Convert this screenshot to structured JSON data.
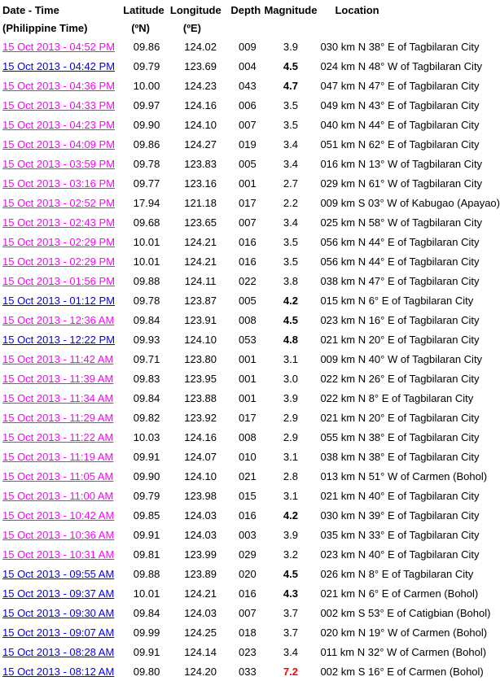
{
  "header": {
    "date_time": "Date - Time",
    "date_time_sub": "(Philippine Time)",
    "latitude": "Latitude",
    "latitude_sub": "(ºN)",
    "longitude": "Longitude",
    "longitude_sub": "(ºE)",
    "depth": "Depth",
    "magnitude": "Magnitude",
    "location": "Location"
  },
  "colors": {
    "link_visited": "#ff00ff",
    "link_unvisited": "#0000ee",
    "magnitude_major": "#ff0000"
  },
  "rows": [
    {
      "datetime": "15 Oct 2013 - 04:52 PM",
      "link": "visited",
      "lat": "09.86",
      "lon": "124.02",
      "depth": "009",
      "mag": "3.9",
      "mag_style": "normal",
      "location": "030 km N 38° E of Tagbilaran City"
    },
    {
      "datetime": "15 Oct 2013 - 04:42 PM",
      "link": "unvisited",
      "lat": "09.79",
      "lon": "123.69",
      "depth": "004",
      "mag": "4.5",
      "mag_style": "bold",
      "location": "024 km N 48° W of Tagbilaran City"
    },
    {
      "datetime": "15 Oct 2013 - 04:36 PM",
      "link": "visited",
      "lat": "10.00",
      "lon": "124.23",
      "depth": "043",
      "mag": "4.7",
      "mag_style": "bold",
      "location": "047 km N 47° E of Tagbilaran City"
    },
    {
      "datetime": "15 Oct 2013 - 04:33 PM",
      "link": "visited",
      "lat": "09.97",
      "lon": "124.16",
      "depth": "006",
      "mag": "3.5",
      "mag_style": "normal",
      "location": "049 km N 43° E of Tagbilaran City"
    },
    {
      "datetime": "15 Oct 2013 - 04:23 PM",
      "link": "visited",
      "lat": "09.90",
      "lon": "124.10",
      "depth": "007",
      "mag": "3.5",
      "mag_style": "normal",
      "location": "040 km N 44° E of Tagbilaran City"
    },
    {
      "datetime": "15 Oct 2013 - 04:09 PM",
      "link": "visited",
      "lat": "09.86",
      "lon": "124.27",
      "depth": "019",
      "mag": "3.4",
      "mag_style": "normal",
      "location": "051 km N 62° E of Tagbilaran City"
    },
    {
      "datetime": "15 Oct 2013 - 03:59 PM",
      "link": "visited",
      "lat": "09.78",
      "lon": "123.83",
      "depth": "005",
      "mag": "3.4",
      "mag_style": "normal",
      "location": "016 km N 13° W of Tagbilaran City"
    },
    {
      "datetime": "15 Oct 2013 - 03:16 PM",
      "link": "visited",
      "lat": "09.77",
      "lon": "123.16",
      "depth": "001",
      "mag": "2.7",
      "mag_style": "normal",
      "location": "029 km N 61° W of Tagbilaran City"
    },
    {
      "datetime": "15 Oct 2013 - 02:52 PM",
      "link": "visited",
      "lat": "17.94",
      "lon": "121.18",
      "depth": "017",
      "mag": "2.2",
      "mag_style": "normal",
      "location": "009 km S 03° W of Kabugao (Apayao)"
    },
    {
      "datetime": "15 Oct 2013 - 02:43 PM",
      "link": "visited",
      "lat": "09.68",
      "lon": "123.65",
      "depth": "007",
      "mag": "3.4",
      "mag_style": "normal",
      "location": "025 km N 58° W of Tagbilaran City"
    },
    {
      "datetime": "15 Oct 2013 - 02:29 PM",
      "link": "visited",
      "lat": "10.01",
      "lon": "124.21",
      "depth": "016",
      "mag": "3.5",
      "mag_style": "normal",
      "location": "056 km N 44° E of Tagbilaran City"
    },
    {
      "datetime": "15 Oct 2013 - 02:29 PM",
      "link": "visited",
      "lat": "10.01",
      "lon": "124.21",
      "depth": "016",
      "mag": "3.5",
      "mag_style": "normal",
      "location": "056 km N 44° E of Tagbilaran City"
    },
    {
      "datetime": "15 Oct 2013 - 01:56 PM",
      "link": "visited",
      "lat": "09.88",
      "lon": "124.11",
      "depth": "022",
      "mag": "3.8",
      "mag_style": "normal",
      "location": "038 km N 47° E of Tagbilaran City"
    },
    {
      "datetime": "15 Oct 2013 - 01:12 PM",
      "link": "unvisited",
      "lat": "09.78",
      "lon": "123.87",
      "depth": "005",
      "mag": "4.2",
      "mag_style": "bold",
      "location": "015 km N 6° E of Tagbilaran City"
    },
    {
      "datetime": "15 Oct 2013 - 12:36 AM",
      "link": "visited",
      "lat": "09.84",
      "lon": "123.91",
      "depth": "008",
      "mag": "4.5",
      "mag_style": "bold",
      "location": "023 km N 16° E of Tagbilaran City"
    },
    {
      "datetime": "15 Oct 2013 - 12:22 PM",
      "link": "unvisited",
      "lat": "09.93",
      "lon": "124.10",
      "depth": "053",
      "mag": "4.8",
      "mag_style": "bold",
      "location": "021 km N 20° E of Tagbilaran City"
    },
    {
      "datetime": "15 Oct 2013 - 11:42 AM",
      "link": "visited",
      "lat": "09.71",
      "lon": "123.80",
      "depth": "001",
      "mag": "3.1",
      "mag_style": "normal",
      "location": "009 km N 40° W of Tagbilaran City"
    },
    {
      "datetime": "15 Oct 2013 - 11:39 AM",
      "link": "visited",
      "lat": "09.83",
      "lon": "123.95",
      "depth": "001",
      "mag": "3.0",
      "mag_style": "normal",
      "location": "022 km N 26° E of Tagbilaran City"
    },
    {
      "datetime": "15 Oct 2013 - 11:34 AM",
      "link": "visited",
      "lat": "09.84",
      "lon": "123.88",
      "depth": "001",
      "mag": "3.9",
      "mag_style": "normal",
      "location": "022 km N 8° E of Tagbilaran City"
    },
    {
      "datetime": "15 Oct 2013 - 11:29 AM",
      "link": "visited",
      "lat": "09.82",
      "lon": "123.92",
      "depth": "017",
      "mag": "2.9",
      "mag_style": "normal",
      "location": "021 km N 20° E of Tagbilaran City"
    },
    {
      "datetime": "15 Oct 2013 - 11:22 AM",
      "link": "visited",
      "lat": "10.03",
      "lon": "124.16",
      "depth": "008",
      "mag": "2.9",
      "mag_style": "normal",
      "location": "055 km N 38° E of Tagbilaran City"
    },
    {
      "datetime": "15 Oct 2013 - 11:19 AM",
      "link": "visited",
      "lat": "09.91",
      "lon": "124.07",
      "depth": "010",
      "mag": "3.1",
      "mag_style": "normal",
      "location": "038 km N 38° E of Tagbilaran City"
    },
    {
      "datetime": "15 Oct 2013 - 11:05 AM",
      "link": "visited",
      "lat": "09.90",
      "lon": "124.10",
      "depth": "021",
      "mag": "2.8",
      "mag_style": "normal",
      "location": "013 km N 51° W of Carmen (Bohol)"
    },
    {
      "datetime": "15 Oct 2013 - 11:00 AM",
      "link": "visited",
      "lat": "09.79",
      "lon": "123.98",
      "depth": "015",
      "mag": "3.1",
      "mag_style": "normal",
      "location": "021 km N 40° E of Tagbilaran City"
    },
    {
      "datetime": "15 Oct 2013 - 10:42 AM",
      "link": "visited",
      "lat": "09.85",
      "lon": "124.03",
      "depth": "016",
      "mag": "4.2",
      "mag_style": "bold",
      "location": "030 km N 39° E of Tagbilaran City"
    },
    {
      "datetime": "15 Oct 2013 - 10:36 AM",
      "link": "visited",
      "lat": "09.91",
      "lon": "124.03",
      "depth": "003",
      "mag": "3.9",
      "mag_style": "normal",
      "location": "035 km N 33° E of Tagbilaran City"
    },
    {
      "datetime": "15 Oct 2013 - 10:31 AM",
      "link": "visited",
      "lat": "09.81",
      "lon": "123.99",
      "depth": "029",
      "mag": "3.2",
      "mag_style": "normal",
      "location": "023 km N 40° E of Tagbilaran City"
    },
    {
      "datetime": "15 Oct 2013 - 09:55 AM",
      "link": "unvisited",
      "lat": "09.88",
      "lon": "123.89",
      "depth": "020",
      "mag": "4.5",
      "mag_style": "bold",
      "location": "026 km N 8° E of Tagbilaran City"
    },
    {
      "datetime": "15 Oct 2013 - 09:37 AM",
      "link": "unvisited",
      "lat": "10.01",
      "lon": "124.21",
      "depth": "016",
      "mag": "4.3",
      "mag_style": "bold",
      "location": "021 km N 6° E of Carmen (Bohol)"
    },
    {
      "datetime": "15 Oct 2013 - 09:30 AM",
      "link": "unvisited",
      "lat": "09.84",
      "lon": "124.03",
      "depth": "007",
      "mag": "3.7",
      "mag_style": "normal",
      "location": "002 km S 53° E of Catigbian (Bohol)"
    },
    {
      "datetime": "15 Oct 2013 - 09:07 AM",
      "link": "unvisited",
      "lat": "09.99",
      "lon": "124.25",
      "depth": "018",
      "mag": "3.7",
      "mag_style": "normal",
      "location": "020 km N 19° W of Carmen (Bohol)"
    },
    {
      "datetime": "15 Oct 2013 - 08:28 AM",
      "link": "unvisited",
      "lat": "09.91",
      "lon": "124.14",
      "depth": "023",
      "mag": "3.4",
      "mag_style": "normal",
      "location": "011 km N 32° W of Carmen (Bohol)"
    },
    {
      "datetime": "15 Oct 2013 - 08:12 AM",
      "link": "unvisited",
      "lat": "09.80",
      "lon": "124.20",
      "depth": "033",
      "mag": "7.2",
      "mag_style": "red",
      "location": "002 km S 16° E of Carmen (Bohol)"
    }
  ]
}
